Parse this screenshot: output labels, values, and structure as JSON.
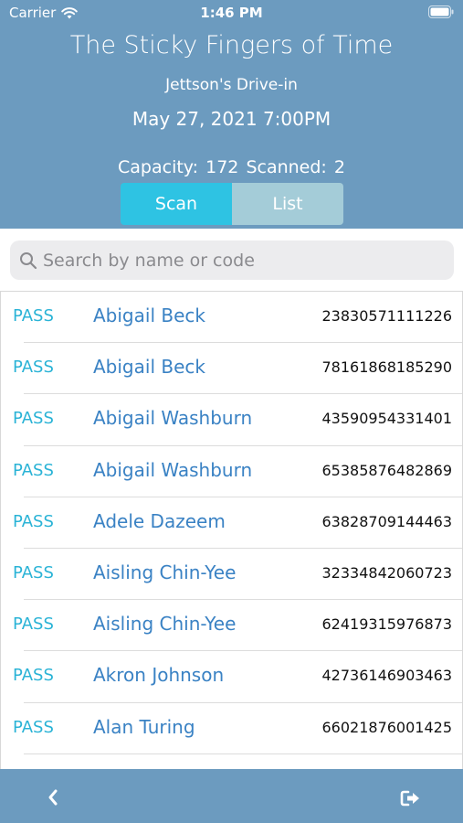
{
  "status_bar": {
    "carrier": "Carrier",
    "time": "1:46 PM"
  },
  "event": {
    "title": "The Sticky Fingers of Time",
    "venue": "Jettson's Drive-in",
    "datetime": "May 27, 2021 7:00PM"
  },
  "stats": {
    "capacity_label": "Capacity:",
    "capacity": "172",
    "scanned_label": "Scanned:",
    "scanned": "2"
  },
  "tabs": {
    "scan": "Scan",
    "list": "List",
    "selected": "scan"
  },
  "search": {
    "placeholder": "Search by name or code",
    "value": ""
  },
  "entries": [
    {
      "status": "PASS",
      "name": "Abigail Beck",
      "code": "23830571111226"
    },
    {
      "status": "PASS",
      "name": "Abigail Beck",
      "code": "78161868185290"
    },
    {
      "status": "PASS",
      "name": "Abigail Washburn",
      "code": "43590954331401"
    },
    {
      "status": "PASS",
      "name": "Abigail Washburn",
      "code": "65385876482869"
    },
    {
      "status": "PASS",
      "name": "Adele Dazeem",
      "code": "63828709144463"
    },
    {
      "status": "PASS",
      "name": "Aisling Chin-Yee",
      "code": "32334842060723"
    },
    {
      "status": "PASS",
      "name": "Aisling Chin-Yee",
      "code": "62419315976873"
    },
    {
      "status": "PASS",
      "name": "Akron Johnson",
      "code": "42736146903463"
    },
    {
      "status": "PASS",
      "name": "Alan Turing",
      "code": "66021876001425"
    }
  ],
  "icons": {
    "wifi": "wifi-icon",
    "battery": "battery-icon",
    "search": "search-icon",
    "back": "chevron-left-icon",
    "logout": "logout-icon"
  },
  "colors": {
    "header": "#6c9bbf",
    "scan_tab": "#2ec3e3",
    "list_tab": "#a4ccd8",
    "status": "#2ab3d6",
    "name": "#3a82c4"
  }
}
